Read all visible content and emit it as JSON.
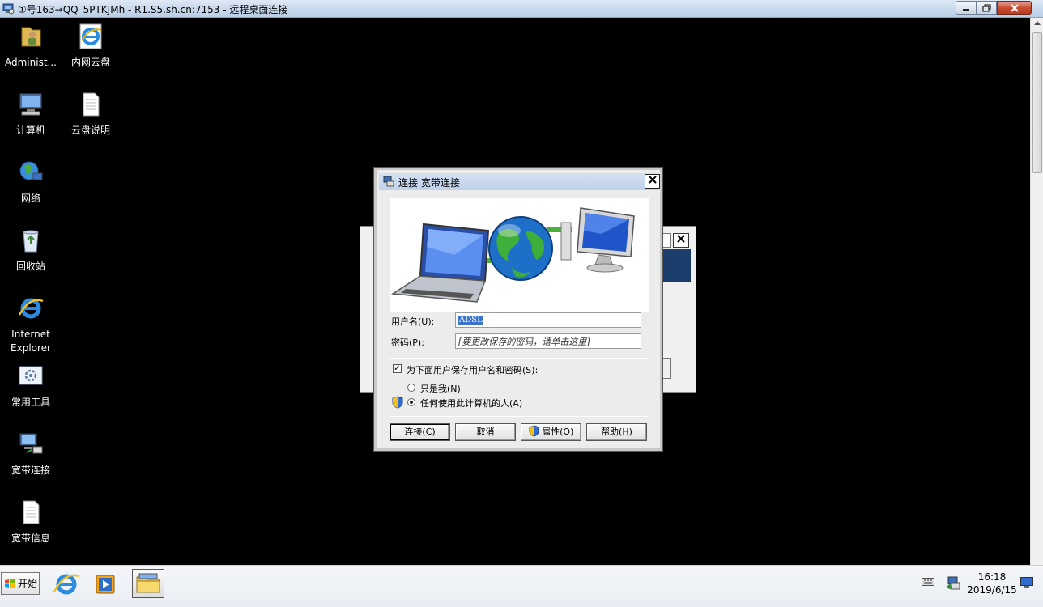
{
  "window": {
    "title": "①号163→QQ_5PTKJMh - R1.S5.sh.cn:7153 - 远程桌面连接",
    "controls": [
      "minimize-icon",
      "maximize-icon",
      "close-icon"
    ]
  },
  "desktop": {
    "icons": [
      {
        "label": "Administ...",
        "icon": "user-folder-icon"
      },
      {
        "label": "内网云盘",
        "icon": "ie-shortcut-icon"
      },
      {
        "label": "计算机",
        "icon": "computer-icon"
      },
      {
        "label": "云盘说明",
        "icon": "text-file-icon"
      },
      {
        "label": "网络",
        "icon": "network-globe-icon"
      },
      {
        "label": "回收站",
        "icon": "recycle-bin-icon"
      },
      {
        "label": "Internet Explorer",
        "icon": "internet-explorer-icon"
      },
      {
        "label": "常用工具",
        "icon": "tools-icon"
      },
      {
        "label": "宽带连接",
        "icon": "broadband-connection-icon"
      },
      {
        "label": "宽带信息",
        "icon": "text-file-icon"
      }
    ]
  },
  "dialog": {
    "title": "连接 宽带连接",
    "username_label": "用户名(U):",
    "username_value": "ADSL",
    "password_label": "密码(P):",
    "password_value": "[要更改保存的密码，请单击这里]",
    "save_label": "为下面用户保存用户名和密码(S):",
    "save_checked": true,
    "radio_me": "只是我(N)",
    "radio_anyone": "任何使用此计算机的人(A)",
    "radio_selected": "anyone",
    "buttons": {
      "connect": "连接(C)",
      "cancel": "取消",
      "properties": "属性(O)",
      "help": "帮助(H)"
    }
  },
  "taskbar": {
    "start_label": "开始",
    "time": "16:18",
    "date": "2019/6/15"
  },
  "colors": {
    "title_bar": "#c7d7ec",
    "desktop": "#000000",
    "selection": "#3a73c9",
    "taskbar": "#eef1f5"
  }
}
